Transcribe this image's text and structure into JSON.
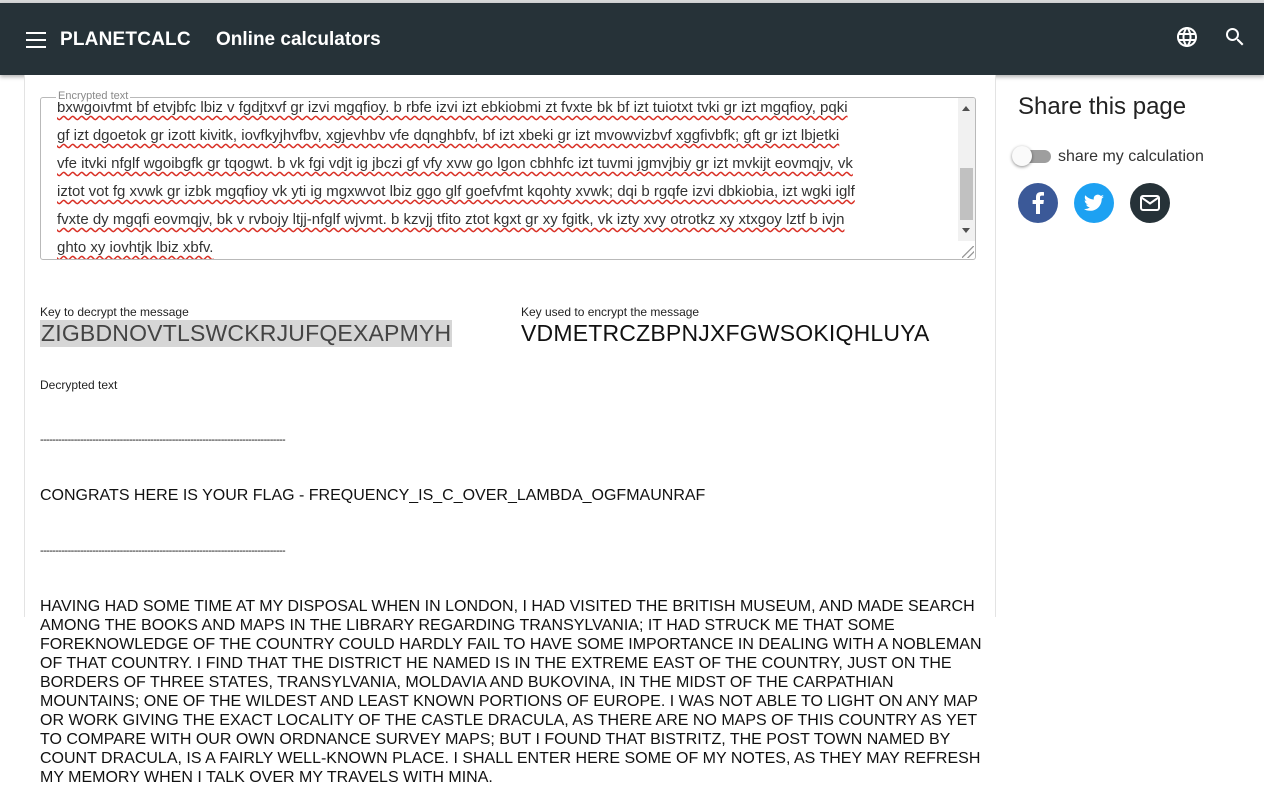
{
  "app": {
    "brand": "PLANETCALC",
    "section_title": "Online calculators",
    "icons": {
      "menu": "menu-icon",
      "language": "globe-icon",
      "search": "search-icon"
    }
  },
  "encrypted": {
    "label": "Encrypted text",
    "lines": [
      "bxwgoivfmt bf etvjbfc lbiz v fgdjtxvf gr izvi mgqfioy. b rbfe izvi izt ebkiobmi zt fvxte bk bf izt tuiotxt tvki gr izt mgqfioy, pqki",
      "gf izt dgoetok gr izott kivitk, iovfkyjhvfbv, xgjevhbv vfe dqnghbfv, bf izt xbeki gr izt mvowvizbvf xggfivbfk; gft gr izt lbjetki",
      "vfe itvki nfglf wgoibgfk gr tqogwt. b vk fgi vdjt ig jbczi gf vfy xvw go lgon cbhhfc izt tuvmi jgmvjbiy gr izt mvkijt eovmqjv, vk",
      "iztot vot fg xvwk gr izbk mgqfioy vk yti ig mgxwvot lbiz ggo glf goefvfmt kqohty xvwk; dqi b rgqfe izvi dbkiobia, izt wgki iglf",
      "fvxte dy mgqfi eovmqjv, bk v rvbojy ltjj-nfglf wjvmt. b kzvjj tfito ztot kgxt gr xy fgitk, vk izty xvy otrotkz xy xtxgoy lztf b ivjn",
      "ghto xy iovhtjk lbiz xbfv."
    ]
  },
  "keys": {
    "decrypt_label": "Key to decrypt the message",
    "decrypt_value": "ZIGBDNOVTLSWCKRJUFQEXAPMYH",
    "encrypt_label": "Key used to encrypt the message",
    "encrypt_value": "VDMETRCZBPNJXFGWSOKIQHLUYA"
  },
  "decrypted": {
    "label": "Decrypted text",
    "dashes": "--------------------------------------------------------------------------------",
    "flag_line": "CONGRATS HERE IS YOUR FLAG - FREQUENCY_IS_C_OVER_LAMBDA_OGFMAUNRAF",
    "body": "HAVING HAD SOME TIME AT MY DISPOSAL WHEN IN LONDON, I HAD VISITED THE BRITISH MUSEUM, AND MADE SEARCH AMONG THE BOOKS AND MAPS IN THE LIBRARY REGARDING TRANSYLVANIA; IT HAD STRUCK ME THAT SOME FOREKNOWLEDGE OF THE COUNTRY COULD HARDLY FAIL TO HAVE SOME IMPORTANCE IN DEALING WITH A NOBLEMAN OF THAT COUNTRY. I FIND THAT THE DISTRICT HE NAMED IS IN THE EXTREME EAST OF THE COUNTRY, JUST ON THE BORDERS OF THREE STATES, TRANSYLVANIA, MOLDAVIA AND BUKOVINA, IN THE MIDST OF THE CARPATHIAN MOUNTAINS; ONE OF THE WILDEST AND LEAST KNOWN PORTIONS OF EUROPE. I WAS NOT ABLE TO LIGHT ON ANY MAP OR WORK GIVING THE EXACT LOCALITY OF THE CASTLE DRACULA, AS THERE ARE NO MAPS OF THIS COUNTRY AS YET TO COMPARE WITH OUR OWN ORDNANCE SURVEY MAPS; BUT I FOUND THAT BISTRITZ, THE POST TOWN NAMED BY COUNT DRACULA, IS A FAIRLY WELL-KNOWN PLACE. I SHALL ENTER HERE SOME OF MY NOTES, AS THEY MAY REFRESH MY MEMORY WHEN I TALK OVER MY TRAVELS WITH MINA."
  },
  "share": {
    "title": "Share this page",
    "toggle_label": "share my calculation",
    "toggle_on": false,
    "buttons": [
      {
        "icon": "facebook-icon",
        "color": "#3b5998"
      },
      {
        "icon": "twitter-icon",
        "color": "#1da1f2"
      },
      {
        "icon": "email-icon",
        "color": "#263238"
      }
    ]
  },
  "colors": {
    "appbar": "#263238",
    "accent_key_bg": "#d6d6d6"
  }
}
